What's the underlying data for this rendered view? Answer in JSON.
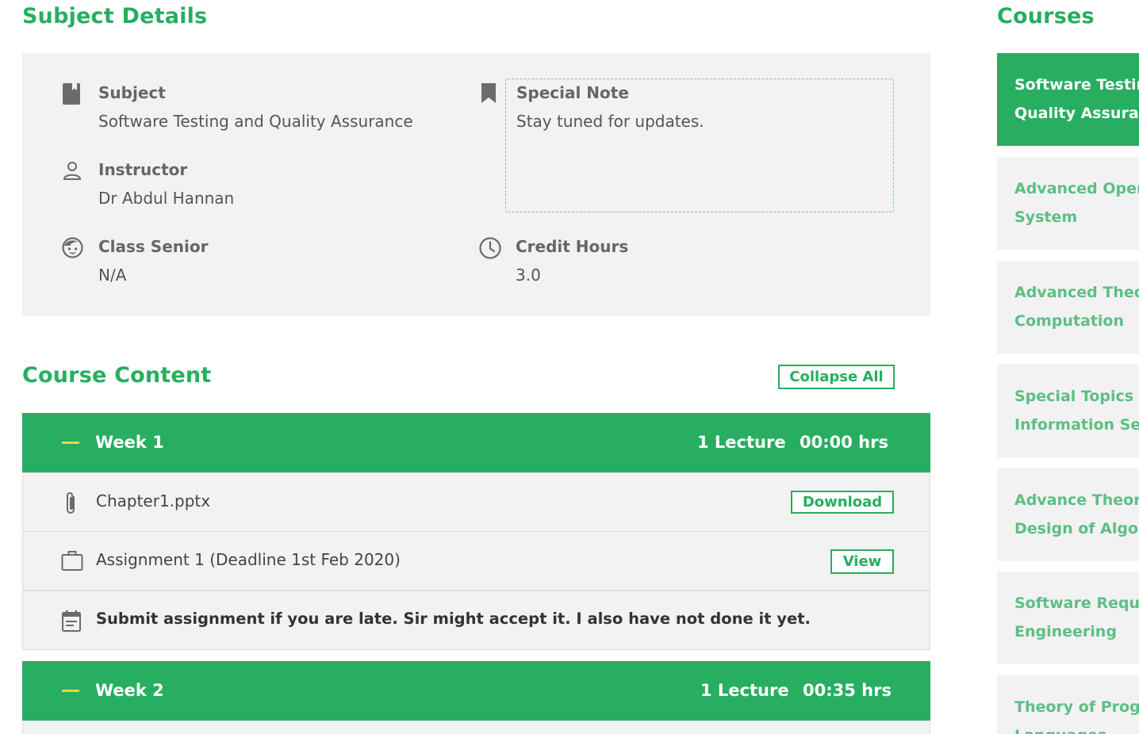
{
  "subject_details": {
    "title": "Subject Details",
    "subject": {
      "label": "Subject",
      "value": "Software Testing and Quality Assurance"
    },
    "instructor": {
      "label": "Instructor",
      "value": "Dr Abdul Hannan"
    },
    "class_senior": {
      "label": "Class Senior",
      "value": "N/A"
    },
    "special_note": {
      "label": "Special Note",
      "value": "Stay tuned for updates."
    },
    "credit_hours": {
      "label": "Credit Hours",
      "value": "3.0"
    }
  },
  "course_content": {
    "title": "Course Content",
    "collapse_label": "Collapse All",
    "weeks": [
      {
        "title": "Week 1",
        "lectures": "1 Lecture",
        "duration": "00:00 hrs",
        "items": [
          {
            "icon": "paperclip-icon",
            "text": "Chapter1.pptx",
            "action": "Download"
          },
          {
            "icon": "briefcase-icon",
            "text": "Assignment 1 (Deadline 1st Feb 2020)",
            "action": "View"
          },
          {
            "icon": "calendar-note-icon",
            "text": "Submit assignment if you are late. Sir might accept it. I also have not done it yet."
          }
        ]
      },
      {
        "title": "Week 2",
        "lectures": "1 Lecture",
        "duration": "00:35 hrs"
      }
    ]
  },
  "courses": {
    "title": "Courses",
    "items": [
      {
        "label": "Software Testing and\nQuality Assurance",
        "active": true
      },
      {
        "label": "Advanced Operating\nSystem"
      },
      {
        "label": "Advanced Theory of\nComputation"
      },
      {
        "label": "Special Topics in\nInformation Security"
      },
      {
        "label": "Advance Theory and\nDesign of Algorithms"
      },
      {
        "label": "Software Requirements\nEngineering"
      },
      {
        "label": "Theory of Programming\nLanguages"
      }
    ]
  },
  "colors": {
    "accent": "#27ae60",
    "panel": "#f2f2f2",
    "dash": "#f1d33c"
  }
}
